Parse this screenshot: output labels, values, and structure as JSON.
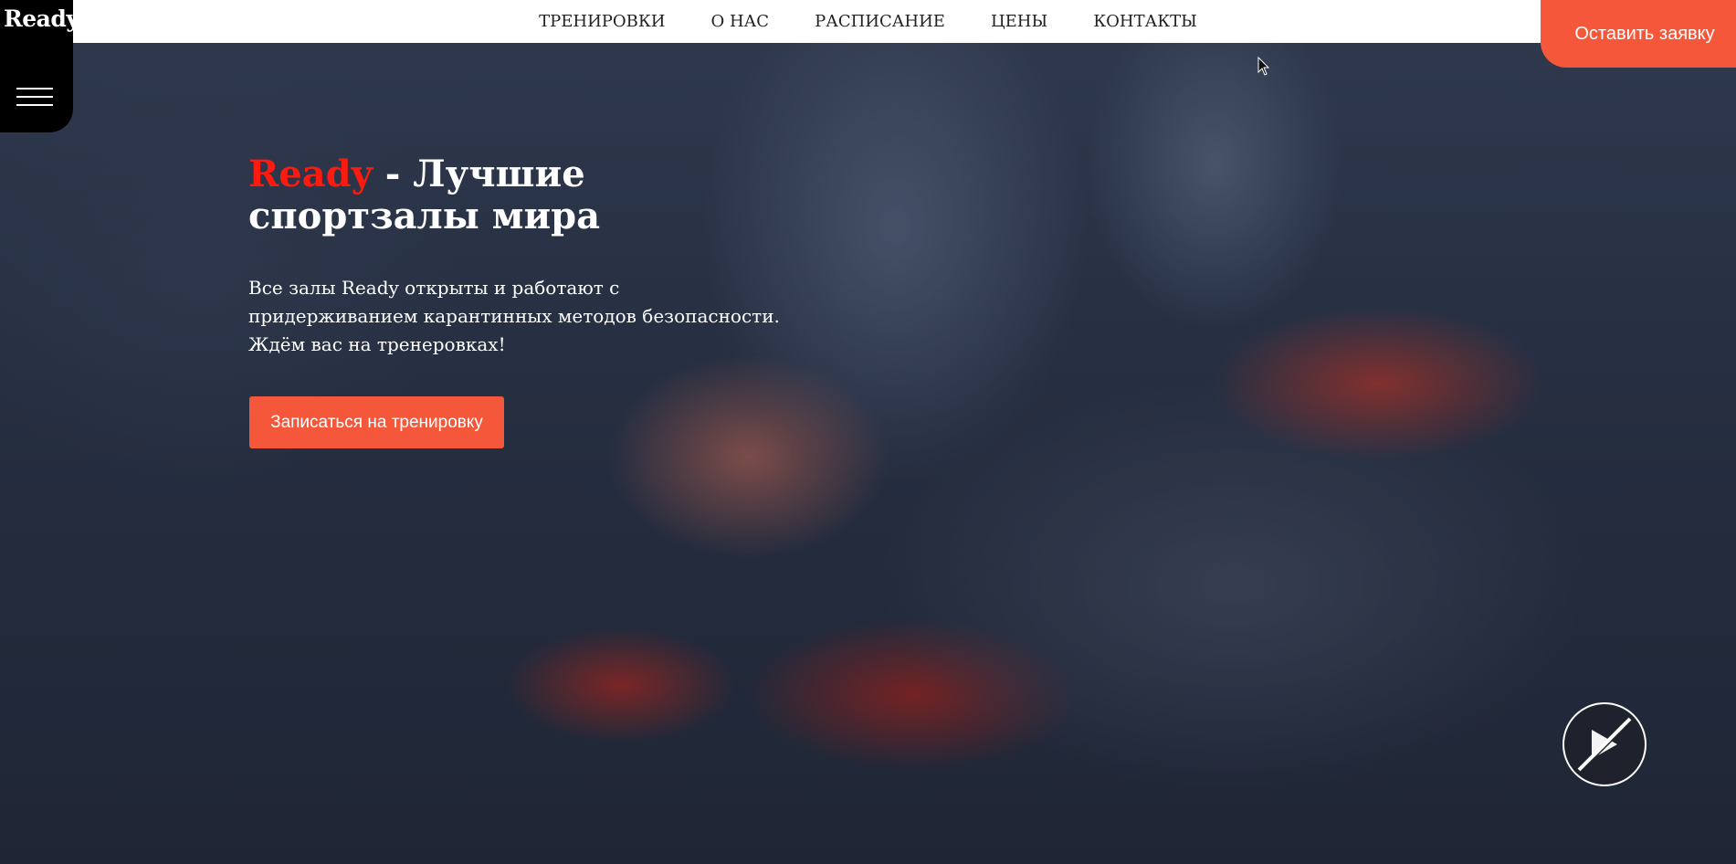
{
  "header": {
    "logo": "Ready",
    "menu_icon": "hamburger-icon",
    "nav": [
      {
        "label": "ТРЕНИРОВКИ"
      },
      {
        "label": "О НАС"
      },
      {
        "label": "РАСПИСАНИЕ"
      },
      {
        "label": "ЦЕНЫ"
      },
      {
        "label": "КОНТАКТЫ"
      }
    ],
    "cta_label": "Оставить заявку"
  },
  "hero": {
    "title_brand": "Ready",
    "title_rest_line1": " - Лучшие",
    "title_line2": "спортзалы мира",
    "desc_lines": [
      "Все залы Ready открыты и работают с",
      "придерживанием карантинных методов безопасности.",
      "Ждём вас на тренеровках!"
    ],
    "button_label": "Записаться на тренировку"
  },
  "video_control": {
    "icon": "video-off-icon"
  },
  "colors": {
    "accent": "#f4573a",
    "brand_red": "#ff1a10",
    "header_bg": "#ffffff",
    "logo_bg": "#000000"
  }
}
